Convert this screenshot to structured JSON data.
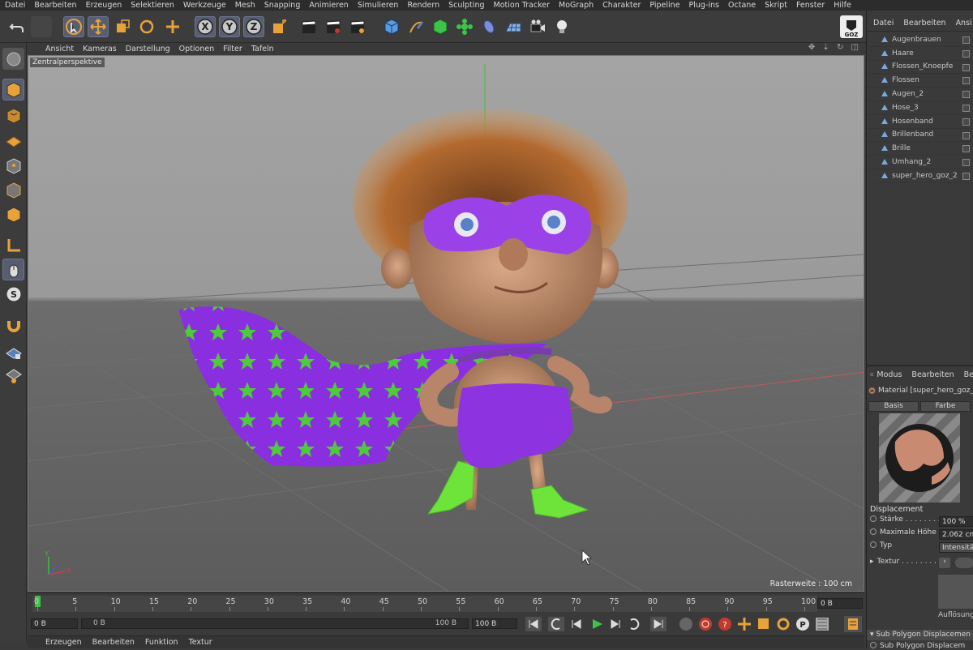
{
  "menubar": [
    "Datei",
    "Bearbeiten",
    "Erzeugen",
    "Selektieren",
    "Werkzeuge",
    "Mesh",
    "Snapping",
    "Animieren",
    "Simulieren",
    "Rendern",
    "Sculpting",
    "Motion Tracker",
    "MoGraph",
    "Charakter",
    "Pipeline",
    "Plug-ins",
    "Octane",
    "Skript",
    "Fenster",
    "Hilfe"
  ],
  "toolbar": {
    "axis_x": "X",
    "axis_y": "Y",
    "axis_z": "Z",
    "goz_label": "GOZ"
  },
  "viewport": {
    "menu": [
      "Ansicht",
      "Kameras",
      "Darstellung",
      "Optionen",
      "Filter",
      "Tafeln"
    ],
    "title": "Zentralperspektive",
    "raster": "Rasterweite : 100 cm",
    "nav_icons": "✥ ⇣ ↻ ◫",
    "axis_y": "Y",
    "axis_x": "X"
  },
  "timeline": {
    "ticks": [
      "0",
      "5",
      "10",
      "15",
      "20",
      "25",
      "30",
      "35",
      "40",
      "45",
      "50",
      "55",
      "60",
      "65",
      "70",
      "75",
      "80",
      "85",
      "90",
      "95",
      "100"
    ],
    "frame_field": "0 B"
  },
  "transport": {
    "start_field": "0 B",
    "range_start": "0 B",
    "range_end": "100 B",
    "end_field": "100 B"
  },
  "bottom_menu": [
    "Erzeugen",
    "Bearbeiten",
    "Funktion",
    "Textur"
  ],
  "object_manager": {
    "menu": [
      "Datei",
      "Bearbeiten",
      "Ansi"
    ],
    "items": [
      "Augenbrauen",
      "Haare",
      "Flossen_Knoepfe",
      "Flossen",
      "Augen_2",
      "Hose_3",
      "Hosenband",
      "Brillenband",
      "Brille",
      "Umhang_2",
      "super_hero_goz_2"
    ]
  },
  "attributes": {
    "menu": [
      "Modus",
      "Bearbeiten",
      "Be"
    ],
    "material_title": "Material [super_hero_goz_",
    "tabs": [
      "Basis",
      "Farbe"
    ],
    "section": "Displacement",
    "fields": [
      {
        "label": "Stärke . . . . . . . .",
        "value": "100 %"
      },
      {
        "label": "Maximale Höhe",
        "value": "2.062 cm"
      },
      {
        "label": "Typ",
        "value": "Intensität"
      }
    ],
    "texture_label": "Textur . . . . . . . . .",
    "texture_arrow": "›",
    "resolution_label": "Auflösung",
    "subsection": "Sub Polygon Displacemen",
    "subrow": "Sub Polygon Displacem"
  },
  "colors": {
    "accent_orange": "#e8a23a",
    "tool_blue": "#5a7fc0",
    "cape_purple": "#8a2fe0",
    "star_green": "#4ecb3a",
    "play_green": "#3ec34a",
    "stop_red": "#c23a2e"
  }
}
